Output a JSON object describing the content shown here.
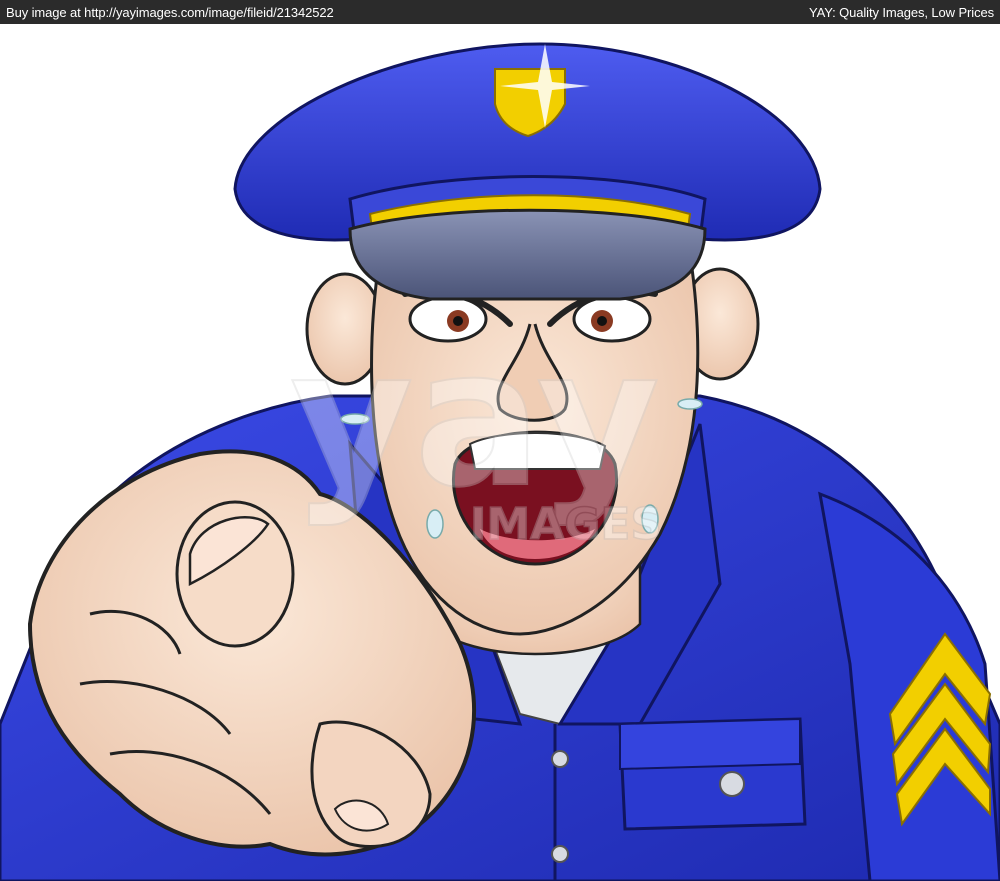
{
  "header": {
    "left_link": "Buy image at http://yayimages.com/image/fileid/21342522",
    "right_text": "YAY: Quality Images, Low Prices"
  },
  "watermark": {
    "logo_text": "yay",
    "sub_text": "IMAGES"
  },
  "colors": {
    "header_bg": "#2b2b2b",
    "uniform": "#2f3fd8",
    "uniform_dark": "#1d27a8",
    "cap_visor": "#5f6a90",
    "badge_gold": "#f2cf00",
    "skin": "#f4d9c4",
    "mouth": "#e06a7a"
  },
  "icons": [
    "cap-badge-icon",
    "sergeant-chevron-icon",
    "button-icon"
  ]
}
